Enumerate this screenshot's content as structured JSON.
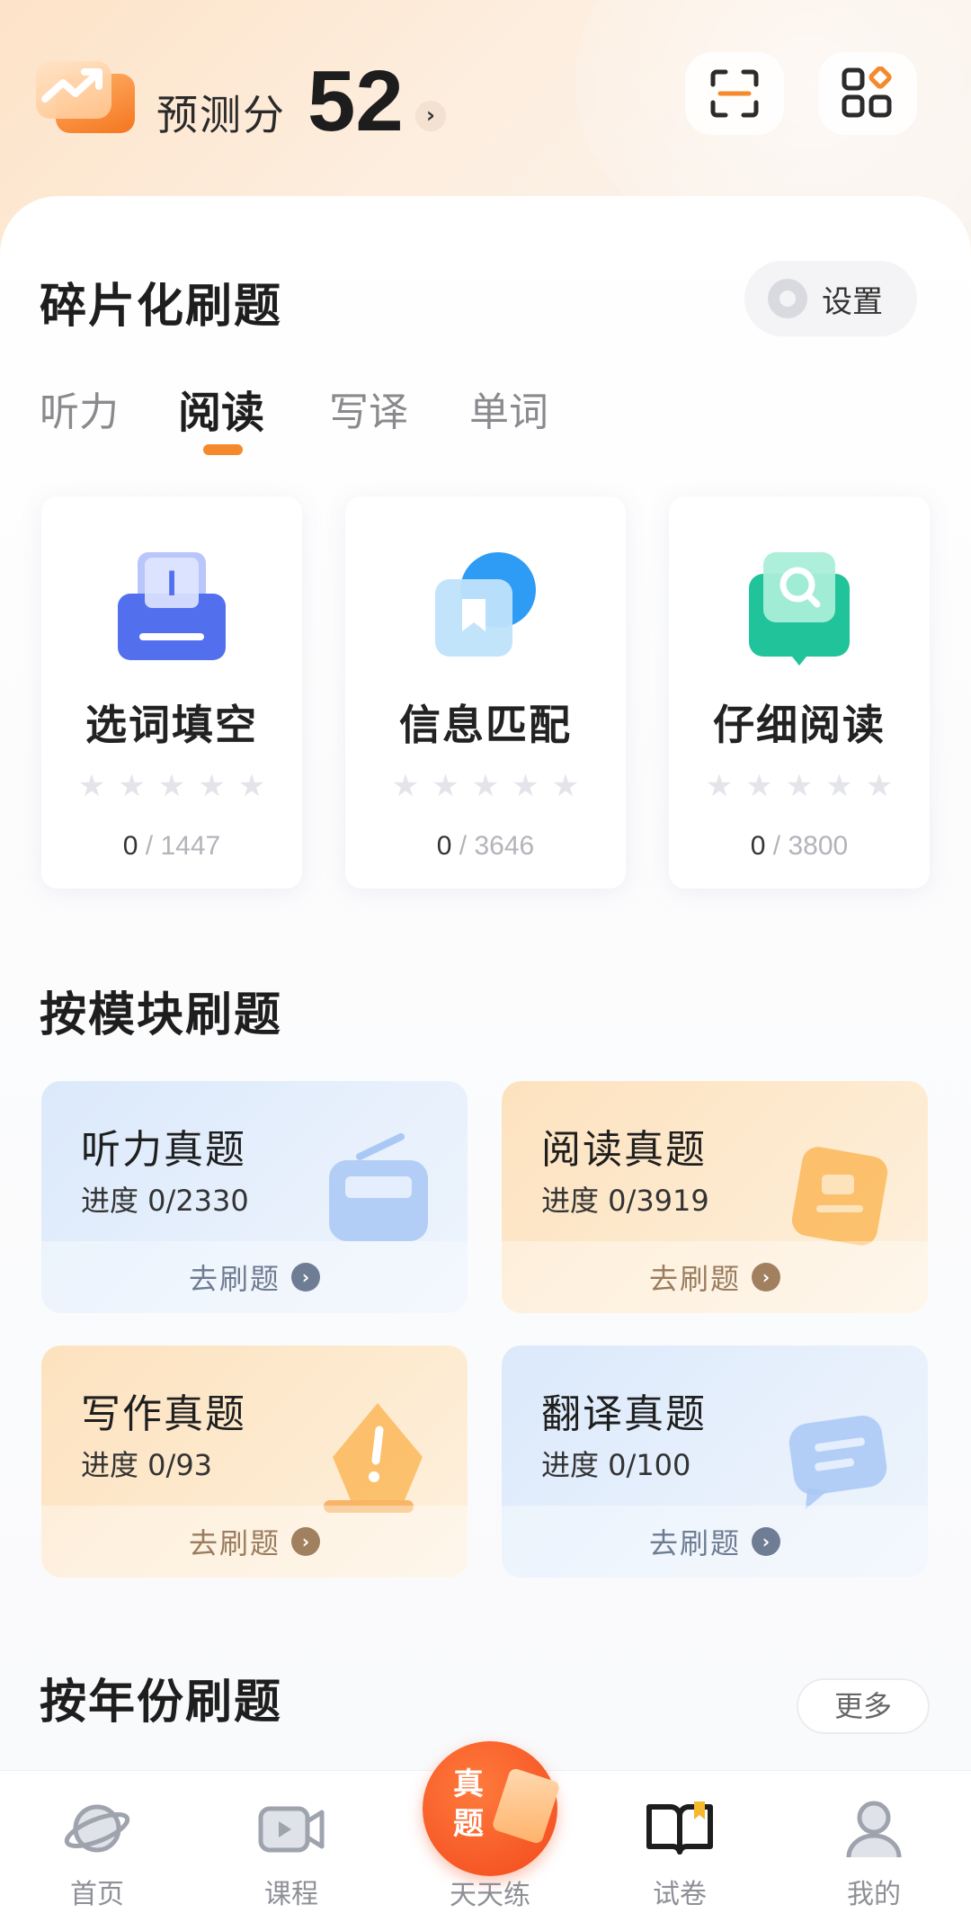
{
  "header": {
    "score_label": "预测分",
    "score_value": "52",
    "score_arrow": "›",
    "icons": {
      "logo": "trend-chart-icon",
      "scan": "scan-icon",
      "apps": "apps-grid-icon"
    }
  },
  "fragment": {
    "title": "碎片化刷题",
    "settings_label": "设置",
    "tabs": [
      {
        "label": "听力",
        "active": false
      },
      {
        "label": "阅读",
        "active": true
      },
      {
        "label": "写译",
        "active": false
      },
      {
        "label": "单词",
        "active": false
      }
    ],
    "cards": [
      {
        "name": "选词填空",
        "stars": "★★★★★",
        "rating": 0,
        "done": "0",
        "total": " / 1447",
        "icon": "text-input-icon"
      },
      {
        "name": "信息匹配",
        "stars": "★★★★★",
        "rating": 0,
        "done": "0",
        "total": " / 3646",
        "icon": "bookmark-match-icon"
      },
      {
        "name": "仔细阅读",
        "stars": "★★★★★",
        "rating": 0,
        "done": "0",
        "total": " / 3800",
        "icon": "search-book-icon"
      }
    ]
  },
  "modules": {
    "title": "按模块刷题",
    "go_label": "去刷题",
    "items": [
      {
        "title": "听力真题",
        "progress": "进度 0/2330",
        "theme": "blue",
        "icon": "radio-icon"
      },
      {
        "title": "阅读真题",
        "progress": "进度 0/3919",
        "theme": "orange",
        "icon": "document-icon"
      },
      {
        "title": "写作真题",
        "progress": "进度 0/93",
        "theme": "orange",
        "icon": "pen-icon"
      },
      {
        "title": "翻译真题",
        "progress": "进度 0/100",
        "theme": "blue",
        "icon": "chat-bubble-icon"
      }
    ]
  },
  "years": {
    "title": "按年份刷题",
    "more_label": "更多"
  },
  "nav": {
    "items": [
      {
        "label": "首页",
        "icon": "planet-icon",
        "active": false
      },
      {
        "label": "课程",
        "icon": "video-icon",
        "active": false
      },
      {
        "label": "天天练",
        "icon": "daily-practice-icon",
        "active": false,
        "badge_text": "真题"
      },
      {
        "label": "试卷",
        "icon": "open-book-icon",
        "active": true
      },
      {
        "label": "我的",
        "icon": "person-icon",
        "active": false
      }
    ]
  },
  "colors": {
    "accent": "#f48a2c",
    "blue_card": "#dbe9fb",
    "orange_card": "#fde2bf",
    "center_button": "#f24a1c"
  }
}
